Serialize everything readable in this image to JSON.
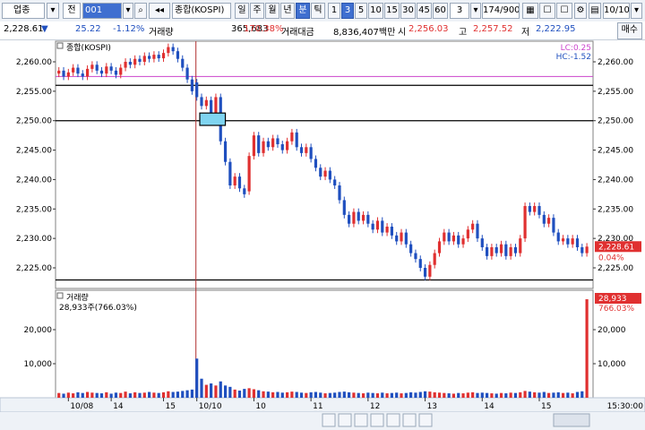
{
  "toolbar": {
    "market": "업종",
    "period_label": "전",
    "code": "001",
    "name": "종합(KOSPI)",
    "period_tabs": [
      "일",
      "주",
      "월",
      "년",
      "분",
      "틱"
    ],
    "selected_period": "분",
    "intervals": [
      "1",
      "3",
      "5",
      "10",
      "15",
      "30",
      "45",
      "60"
    ],
    "selected_interval": "3",
    "count": "3",
    "bar_count": "174/900",
    "date_value": "10/10"
  },
  "info": {
    "price": "2,228.61",
    "change": "25.22",
    "change_pct": "-1.12%",
    "volume_label": "거래량",
    "volume": "365,683",
    "volume_ratio": "170.38%",
    "amount_label": "거래대금",
    "amount": "8,836,407백만",
    "open_label": "시",
    "open": "2,256.03",
    "high_label": "고",
    "high": "2,257.52",
    "low_label": "저",
    "low": "2,222.95",
    "order_button": "매수"
  },
  "chart_data": {
    "type": "candlestick",
    "title": "종합(KOSPI)",
    "ylim": [
      2221.5,
      2263.5
    ],
    "y_ticks": [
      2225,
      2230,
      2235,
      2240,
      2245,
      2250,
      2255,
      2260
    ],
    "y_tick_labels": [
      "2,225.00",
      "2,230.00",
      "2,235.00",
      "2,240.00",
      "2,245.00",
      "2,250.00",
      "2,255.00",
      "2,260.00"
    ],
    "legend_right_top": "LC:0.25",
    "legend_right_bottom": "HC:-1.52",
    "current_price_label": "2,228.61",
    "current_pct_label": "0.04%",
    "horizontal_lines": [
      2257.5,
      2256.0,
      2250.0,
      2222.95
    ],
    "x_tick_labels": [
      "10/08",
      "14",
      "15",
      "10/10",
      "10",
      "11",
      "12",
      "13",
      "14",
      "15"
    ],
    "volume_panel": {
      "title": "거래량",
      "value_label": "28,933주(766.03%)",
      "right_value": "28,933",
      "right_pct": "766.03%",
      "y_ticks": [
        10000,
        20000
      ],
      "y_tick_labels": [
        "10,000",
        "20,000"
      ],
      "ylim": [
        0,
        30000
      ]
    },
    "time_label": "15:30:00",
    "series": [
      {
        "t": 0,
        "o": 2258.0,
        "c": 2258.5,
        "v": 1400
      },
      {
        "t": 1,
        "o": 2258.5,
        "c": 2257.5,
        "v": 1200
      },
      {
        "t": 2,
        "o": 2257.5,
        "c": 2258.2,
        "v": 1500
      },
      {
        "t": 3,
        "o": 2258.2,
        "c": 2259.0,
        "v": 1300
      },
      {
        "t": 4,
        "o": 2259.0,
        "c": 2258.0,
        "v": 1600
      },
      {
        "t": 5,
        "o": 2258.0,
        "c": 2257.5,
        "v": 1400
      },
      {
        "t": 6,
        "o": 2257.5,
        "c": 2258.8,
        "v": 1700
      },
      {
        "t": 7,
        "o": 2258.8,
        "c": 2259.5,
        "v": 1500
      },
      {
        "t": 8,
        "o": 2259.5,
        "c": 2258.5,
        "v": 1400
      },
      {
        "t": 9,
        "o": 2258.5,
        "c": 2258.0,
        "v": 1300
      },
      {
        "t": 10,
        "o": 2258.0,
        "c": 2259.2,
        "v": 1600
      },
      {
        "t": 11,
        "o": 2259.2,
        "c": 2258.5,
        "v": 1200
      },
      {
        "t": 12,
        "o": 2258.5,
        "c": 2257.8,
        "v": 1500
      },
      {
        "t": 13,
        "o": 2257.8,
        "c": 2259.0,
        "v": 1400
      },
      {
        "t": 14,
        "o": 2259.0,
        "c": 2260.0,
        "v": 1800
      },
      {
        "t": 15,
        "o": 2260.0,
        "c": 2259.5,
        "v": 1300
      },
      {
        "t": 16,
        "o": 2259.5,
        "c": 2260.5,
        "v": 1600
      },
      {
        "t": 17,
        "o": 2260.5,
        "c": 2260.0,
        "v": 1400
      },
      {
        "t": 18,
        "o": 2260.0,
        "c": 2261.0,
        "v": 1500
      },
      {
        "t": 19,
        "o": 2261.0,
        "c": 2260.5,
        "v": 1700
      },
      {
        "t": 20,
        "o": 2260.5,
        "c": 2261.2,
        "v": 1500
      },
      {
        "t": 21,
        "o": 2261.2,
        "c": 2260.6,
        "v": 1400
      },
      {
        "t": 22,
        "o": 2260.6,
        "c": 2261.5,
        "v": 1600
      },
      {
        "t": 23,
        "o": 2261.5,
        "c": 2262.5,
        "v": 1900
      },
      {
        "t": 24,
        "o": 2262.5,
        "c": 2261.8,
        "v": 1700
      },
      {
        "t": 25,
        "o": 2261.8,
        "c": 2260.5,
        "v": 1800
      },
      {
        "t": 26,
        "o": 2260.5,
        "c": 2259.0,
        "v": 2000
      },
      {
        "t": 27,
        "o": 2259.0,
        "c": 2257.0,
        "v": 2200
      },
      {
        "t": 28,
        "o": 2257.0,
        "c": 2255.0,
        "v": 2400
      },
      {
        "t": 29,
        "o": 2256.5,
        "c": 2254.0,
        "v": 11500
      },
      {
        "t": 30,
        "o": 2254.0,
        "c": 2252.5,
        "v": 5600
      },
      {
        "t": 31,
        "o": 2252.5,
        "c": 2253.5,
        "v": 3800
      },
      {
        "t": 32,
        "o": 2253.5,
        "c": 2251.0,
        "v": 4200
      },
      {
        "t": 33,
        "o": 2251.0,
        "c": 2254.0,
        "v": 3600
      },
      {
        "t": 34,
        "o": 2254.0,
        "c": 2246.5,
        "v": 4800
      },
      {
        "t": 35,
        "o": 2246.5,
        "c": 2243.0,
        "v": 3600
      },
      {
        "t": 36,
        "o": 2243.0,
        "c": 2239.0,
        "v": 3200
      },
      {
        "t": 37,
        "o": 2239.0,
        "c": 2240.5,
        "v": 2400
      },
      {
        "t": 38,
        "o": 2240.5,
        "c": 2238.5,
        "v": 2100
      },
      {
        "t": 39,
        "o": 2238.5,
        "c": 2237.5,
        "v": 2600
      },
      {
        "t": 40,
        "o": 2238.0,
        "c": 2244.0,
        "v": 2800
      },
      {
        "t": 41,
        "o": 2244.0,
        "c": 2247.5,
        "v": 2500
      },
      {
        "t": 42,
        "o": 2247.5,
        "c": 2244.5,
        "v": 2200
      },
      {
        "t": 43,
        "o": 2244.5,
        "c": 2246.5,
        "v": 1900
      },
      {
        "t": 44,
        "o": 2246.5,
        "c": 2245.5,
        "v": 1800
      },
      {
        "t": 45,
        "o": 2245.5,
        "c": 2247.0,
        "v": 1600
      },
      {
        "t": 46,
        "o": 2247.0,
        "c": 2246.0,
        "v": 1700
      },
      {
        "t": 47,
        "o": 2246.0,
        "c": 2245.0,
        "v": 1500
      },
      {
        "t": 48,
        "o": 2245.0,
        "c": 2246.5,
        "v": 1600
      },
      {
        "t": 49,
        "o": 2246.5,
        "c": 2248.0,
        "v": 1800
      },
      {
        "t": 50,
        "o": 2248.0,
        "c": 2245.5,
        "v": 1700
      },
      {
        "t": 51,
        "o": 2245.5,
        "c": 2244.5,
        "v": 1500
      },
      {
        "t": 52,
        "o": 2244.5,
        "c": 2245.5,
        "v": 1400
      },
      {
        "t": 53,
        "o": 2245.5,
        "c": 2243.5,
        "v": 1600
      },
      {
        "t": 54,
        "o": 2243.5,
        "c": 2242.0,
        "v": 1700
      },
      {
        "t": 55,
        "o": 2242.0,
        "c": 2240.5,
        "v": 1500
      },
      {
        "t": 56,
        "o": 2240.5,
        "c": 2241.5,
        "v": 1300
      },
      {
        "t": 57,
        "o": 2241.5,
        "c": 2240.0,
        "v": 1400
      },
      {
        "t": 58,
        "o": 2240.0,
        "c": 2239.0,
        "v": 1500
      },
      {
        "t": 59,
        "o": 2239.0,
        "c": 2236.5,
        "v": 1700
      },
      {
        "t": 60,
        "o": 2236.5,
        "c": 2234.0,
        "v": 1800
      },
      {
        "t": 61,
        "o": 2234.0,
        "c": 2232.5,
        "v": 1600
      },
      {
        "t": 62,
        "o": 2232.5,
        "c": 2234.5,
        "v": 1500
      },
      {
        "t": 63,
        "o": 2234.5,
        "c": 2233.0,
        "v": 1400
      },
      {
        "t": 64,
        "o": 2233.0,
        "c": 2234.0,
        "v": 1300
      },
      {
        "t": 65,
        "o": 2234.0,
        "c": 2232.5,
        "v": 1500
      },
      {
        "t": 66,
        "o": 2232.5,
        "c": 2231.5,
        "v": 1400
      },
      {
        "t": 67,
        "o": 2231.5,
        "c": 2233.0,
        "v": 1300
      },
      {
        "t": 68,
        "o": 2233.0,
        "c": 2231.0,
        "v": 1500
      },
      {
        "t": 69,
        "o": 2231.0,
        "c": 2232.0,
        "v": 1300
      },
      {
        "t": 70,
        "o": 2232.0,
        "c": 2230.5,
        "v": 1400
      },
      {
        "t": 71,
        "o": 2230.5,
        "c": 2229.5,
        "v": 1500
      },
      {
        "t": 72,
        "o": 2229.5,
        "c": 2231.0,
        "v": 1300
      },
      {
        "t": 73,
        "o": 2231.0,
        "c": 2229.0,
        "v": 1400
      },
      {
        "t": 74,
        "o": 2229.0,
        "c": 2227.5,
        "v": 1600
      },
      {
        "t": 75,
        "o": 2227.5,
        "c": 2226.5,
        "v": 1500
      },
      {
        "t": 76,
        "o": 2226.5,
        "c": 2225.0,
        "v": 1700
      },
      {
        "t": 77,
        "o": 2225.0,
        "c": 2223.5,
        "v": 1900
      },
      {
        "t": 78,
        "o": 2223.5,
        "c": 2225.5,
        "v": 1800
      },
      {
        "t": 79,
        "o": 2225.5,
        "c": 2227.5,
        "v": 1600
      },
      {
        "t": 80,
        "o": 2227.5,
        "c": 2229.5,
        "v": 1500
      },
      {
        "t": 81,
        "o": 2229.5,
        "c": 2231.0,
        "v": 1400
      },
      {
        "t": 82,
        "o": 2231.0,
        "c": 2229.5,
        "v": 1300
      },
      {
        "t": 83,
        "o": 2229.5,
        "c": 2230.5,
        "v": 1200
      },
      {
        "t": 84,
        "o": 2230.5,
        "c": 2229.0,
        "v": 1400
      },
      {
        "t": 85,
        "o": 2229.0,
        "c": 2230.0,
        "v": 1300
      },
      {
        "t": 86,
        "o": 2230.0,
        "c": 2231.5,
        "v": 1500
      },
      {
        "t": 87,
        "o": 2231.5,
        "c": 2232.5,
        "v": 1600
      },
      {
        "t": 88,
        "o": 2232.5,
        "c": 2230.0,
        "v": 1400
      },
      {
        "t": 89,
        "o": 2230.0,
        "c": 2228.5,
        "v": 1500
      },
      {
        "t": 90,
        "o": 2228.5,
        "c": 2227.0,
        "v": 1400
      },
      {
        "t": 91,
        "o": 2227.0,
        "c": 2228.5,
        "v": 1300
      },
      {
        "t": 92,
        "o": 2228.5,
        "c": 2227.5,
        "v": 1200
      },
      {
        "t": 93,
        "o": 2227.5,
        "c": 2229.0,
        "v": 1400
      },
      {
        "t": 94,
        "o": 2229.0,
        "c": 2227.0,
        "v": 1300
      },
      {
        "t": 95,
        "o": 2227.0,
        "c": 2228.5,
        "v": 1500
      },
      {
        "t": 96,
        "o": 2228.5,
        "c": 2227.5,
        "v": 1400
      },
      {
        "t": 97,
        "o": 2227.5,
        "c": 2230.0,
        "v": 1600
      },
      {
        "t": 98,
        "o": 2230.0,
        "c": 2235.5,
        "v": 2000
      },
      {
        "t": 99,
        "o": 2235.5,
        "c": 2234.5,
        "v": 1800
      },
      {
        "t": 100,
        "o": 2234.5,
        "c": 2235.5,
        "v": 1600
      },
      {
        "t": 101,
        "o": 2235.5,
        "c": 2234.0,
        "v": 1500
      },
      {
        "t": 102,
        "o": 2234.0,
        "c": 2232.5,
        "v": 1700
      },
      {
        "t": 103,
        "o": 2232.5,
        "c": 2233.5,
        "v": 1400
      },
      {
        "t": 104,
        "o": 2233.5,
        "c": 2231.0,
        "v": 1500
      },
      {
        "t": 105,
        "o": 2231.0,
        "c": 2229.5,
        "v": 1600
      },
      {
        "t": 106,
        "o": 2229.5,
        "c": 2230.0,
        "v": 1400
      },
      {
        "t": 107,
        "o": 2230.0,
        "c": 2229.0,
        "v": 1500
      },
      {
        "t": 108,
        "o": 2229.0,
        "c": 2230.0,
        "v": 1300
      },
      {
        "t": 109,
        "o": 2230.0,
        "c": 2228.5,
        "v": 1700
      },
      {
        "t": 110,
        "o": 2228.5,
        "c": 2227.5,
        "v": 1900
      },
      {
        "t": 111,
        "o": 2227.5,
        "c": 2228.61,
        "v": 28933
      }
    ]
  },
  "axis_colors": {
    "up": "#e03030",
    "down": "#1f4fbf",
    "cursor_line": "#b03030",
    "pink_line": "#cc44cc",
    "highlight_box": "#7fd4f0"
  }
}
